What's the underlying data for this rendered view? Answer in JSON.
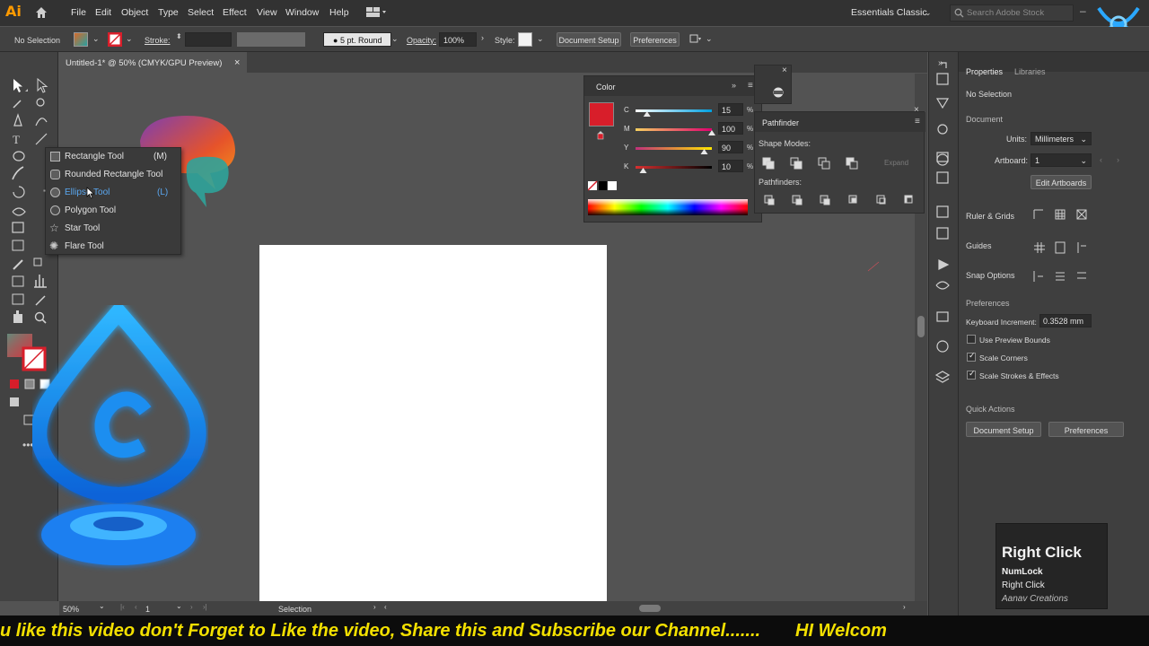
{
  "app": {
    "logo_text": "Ai",
    "accent": "#ff9a00"
  },
  "menu": [
    "File",
    "Edit",
    "Object",
    "Type",
    "Select",
    "Effect",
    "View",
    "Window",
    "Help"
  ],
  "workspace": "Essentials Classic",
  "search": {
    "placeholder": "Search Adobe Stock"
  },
  "control_bar": {
    "selection": "No Selection",
    "stroke_label": "Stroke:",
    "brush": "5 pt. Round",
    "opacity_label": "Opacity:",
    "opacity_value": "100%",
    "style_label": "Style:",
    "doc_setup": "Document Setup",
    "preferences": "Preferences"
  },
  "tab": {
    "title": "Untitled-1* @ 50% (CMYK/GPU Preview)",
    "close": "×"
  },
  "flyout": [
    {
      "label": "Rectangle Tool",
      "shortcut": "(M)",
      "icon": "rectangle-icon"
    },
    {
      "label": "Rounded Rectangle Tool",
      "shortcut": "",
      "icon": "rounded-rectangle-icon"
    },
    {
      "label": "Ellipse Tool",
      "shortcut": "(L)",
      "icon": "ellipse-icon"
    },
    {
      "label": "Polygon Tool",
      "shortcut": "",
      "icon": "polygon-icon"
    },
    {
      "label": "Star Tool",
      "shortcut": "",
      "icon": "star-icon"
    },
    {
      "label": "Flare Tool",
      "shortcut": "",
      "icon": "flare-icon"
    }
  ],
  "color_panel": {
    "title": "Color",
    "channels": [
      {
        "label": "C",
        "value": "15",
        "unit": "%",
        "level": 0.15
      },
      {
        "label": "M",
        "value": "100",
        "unit": "%",
        "level": 1.0
      },
      {
        "label": "Y",
        "value": "90",
        "unit": "%",
        "level": 0.9
      },
      {
        "label": "K",
        "value": "10",
        "unit": "%",
        "level": 0.1
      }
    ],
    "swatch_color": "#d81e2a"
  },
  "pathfinder": {
    "title": "Pathfinder",
    "shape_modes": "Shape Modes:",
    "expand": "Expand",
    "pathfinders": "Pathfinders:"
  },
  "properties": {
    "tab1": "Properties",
    "tab2": "Libraries",
    "selection": "No Selection",
    "document": "Document",
    "units_label": "Units:",
    "units_value": "Millimeters",
    "artboard_label": "Artboard:",
    "artboard_value": "1",
    "edit_artboards": "Edit Artboards",
    "rulers_grids": "Ruler & Grids",
    "guides": "Guides",
    "snap_options": "Snap Options",
    "preferences": "Preferences",
    "keyboard_increment_label": "Keyboard Increment:",
    "keyboard_increment_value": "0.3528 mm",
    "use_preview_bounds": "Use Preview Bounds",
    "scale_corners": "Scale Corners",
    "scale_strokes": "Scale Strokes & Effects",
    "quick_actions": "Quick Actions",
    "doc_setup": "Document Setup",
    "prefs_btn": "Preferences"
  },
  "status": {
    "zoom": "50%",
    "artboard": "1",
    "tool": "Selection"
  },
  "notification": {
    "title": "Right Click",
    "line1": "NumLock",
    "line2": "Right Click",
    "line3": "Aanav Creations"
  },
  "ticker": "u like this video don't Forget to Like the video, Share this and Subscribe our Channel.......       HI Welcom"
}
